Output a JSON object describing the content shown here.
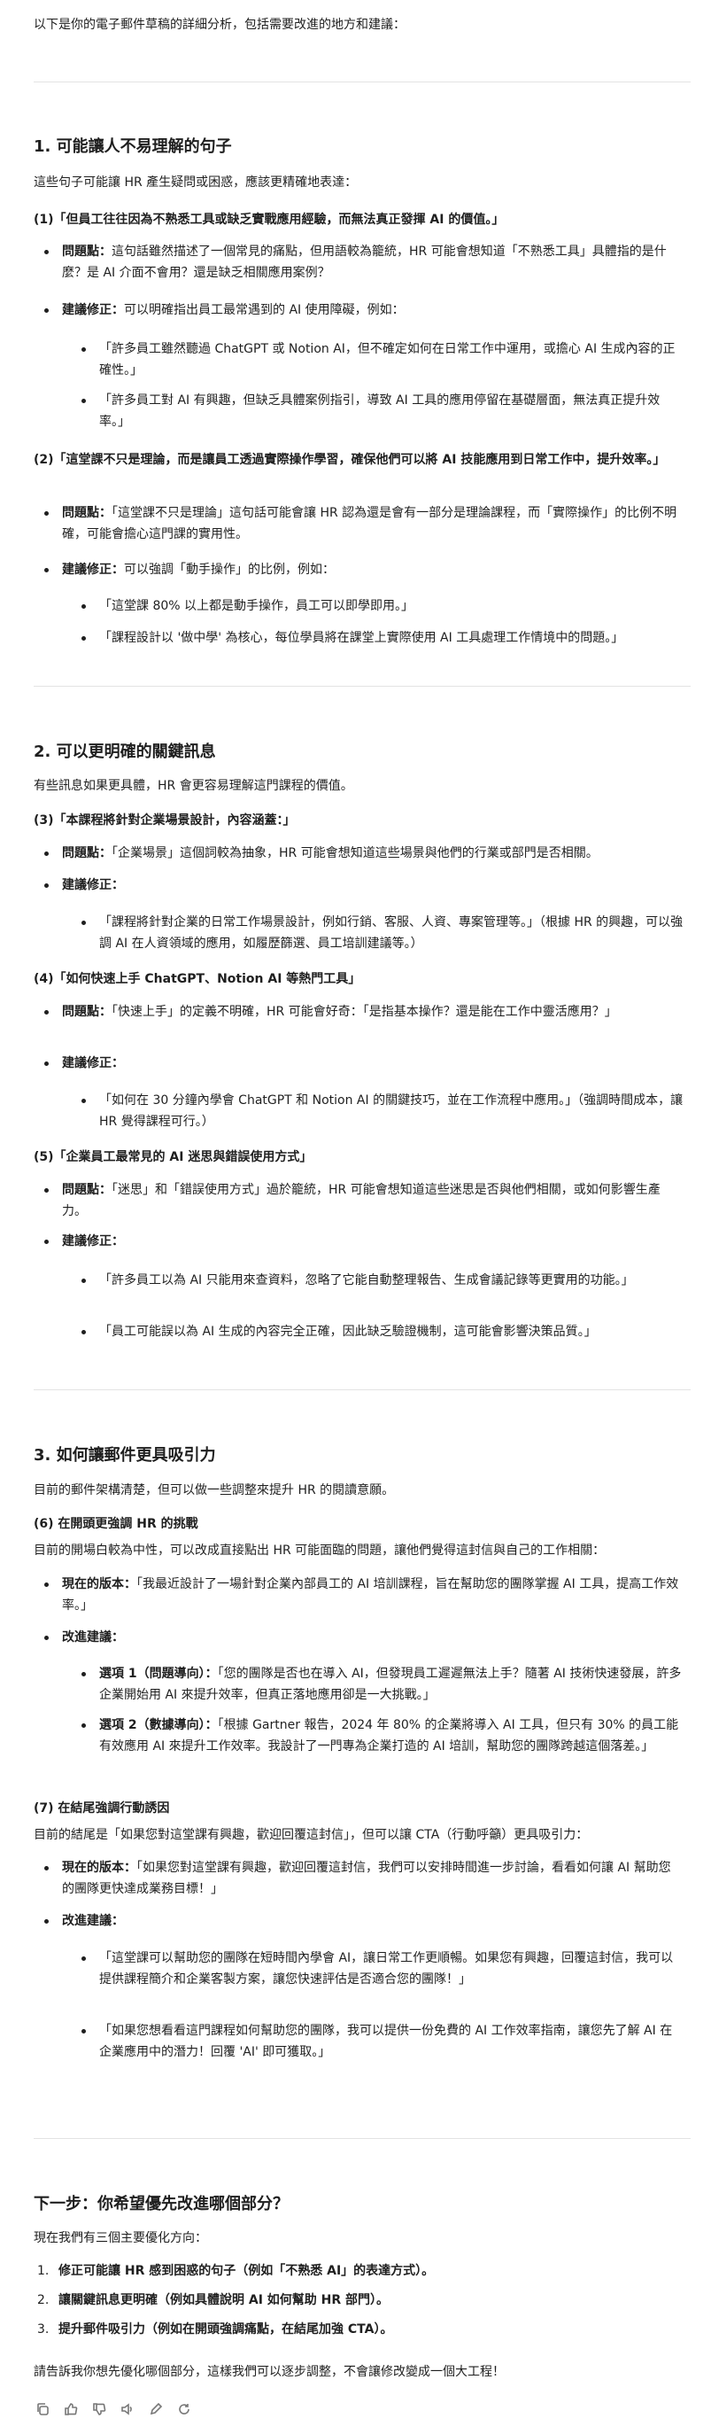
{
  "intro": "以下是你的電子郵件草稿的詳細分析，包括需要改進的地方和建議：",
  "section1": {
    "title": "1. 可能讓人不易理解的句子",
    "desc": "這些句子可能讓 HR 產生疑問或困惑，應該更精確地表達：",
    "q1": "(1)「但員工往往因為不熟悉工具或缺乏實戰應用經驗，而無法真正發揮 AI 的價值。」",
    "q1_problem_label": "問題點：",
    "q1_problem": "這句話雖然描述了一個常見的痛點，但用語較為籠統，HR 可能會想知道「不熟悉工具」具體指的是什麼？是 AI 介面不會用？還是缺乏相關應用案例？",
    "q1_fix_label": "建議修正：",
    "q1_fix": "可以明確指出員工最常遇到的 AI 使用障礙，例如：",
    "q1_s1": "「許多員工雖然聽過 ChatGPT 或 Notion AI，但不確定如何在日常工作中運用，或擔心 AI 生成內容的正確性。」",
    "q1_s2": "「許多員工對 AI 有興趣，但缺乏具體案例指引，導致 AI 工具的應用停留在基礎層面，無法真正提升效率。」",
    "q2": "(2)「這堂課不只是理論，而是讓員工透過實際操作學習，確保他們可以將 AI 技能應用到日常工作中，提升效率。」",
    "q2_problem_label": "問題點：",
    "q2_problem": "「這堂課不只是理論」這句話可能會讓 HR 認為還是會有一部分是理論課程，而「實際操作」的比例不明確，可能會擔心這門課的實用性。",
    "q2_fix_label": "建議修正：",
    "q2_fix": "可以強調「動手操作」的比例，例如：",
    "q2_s1": "「這堂課 80% 以上都是動手操作，員工可以即學即用。」",
    "q2_s2": "「課程設計以 '做中學' 為核心，每位學員將在課堂上實際使用 AI 工具處理工作情境中的問題。」"
  },
  "section2": {
    "title": "2. 可以更明確的關鍵訊息",
    "desc": "有些訊息如果更具體，HR 會更容易理解這門課程的價值。",
    "q3": "(3)「本課程將針對企業場景設計，內容涵蓋：」",
    "q3_problem_label": "問題點：",
    "q3_problem": "「企業場景」這個詞較為抽象，HR 可能會想知道這些場景與他們的行業或部門是否相關。",
    "q3_fix_label": "建議修正：",
    "q3_s1": "「課程將針對企業的日常工作場景設計，例如行銷、客服、人資、專案管理等。」（根據 HR 的興趣，可以強調 AI 在人資領域的應用，如履歷篩選、員工培訓建議等。）",
    "q4": "(4)「如何快速上手 ChatGPT、Notion AI 等熱門工具」",
    "q4_problem_label": "問題點：",
    "q4_problem": "「快速上手」的定義不明確，HR 可能會好奇：「是指基本操作？還是能在工作中靈活應用？」",
    "q4_fix_label": "建議修正：",
    "q4_s1": "「如何在 30 分鐘內學會 ChatGPT 和 Notion AI 的關鍵技巧，並在工作流程中應用。」（強調時間成本，讓 HR 覺得課程可行。）",
    "q5": "(5)「企業員工最常見的 AI 迷思與錯誤使用方式」",
    "q5_problem_label": "問題點：",
    "q5_problem": "「迷思」和「錯誤使用方式」過於籠統，HR 可能會想知道這些迷思是否與他們相關，或如何影響生產力。",
    "q5_fix_label": "建議修正：",
    "q5_s1": "「許多員工以為 AI 只能用來查資料，忽略了它能自動整理報告、生成會議記錄等更實用的功能。」",
    "q5_s2": "「員工可能誤以為 AI 生成的內容完全正確，因此缺乏驗證機制，這可能會影響決策品質。」"
  },
  "section3": {
    "title": "3. 如何讓郵件更具吸引力",
    "desc": "目前的郵件架構清楚，但可以做一些調整來提升 HR 的閱讀意願。",
    "q6": "(6) 在開頭更強調 HR 的挑戰",
    "q6_desc": "目前的開場白較為中性，可以改成直接點出 HR 可能面臨的問題，讓他們覺得這封信與自己的工作相關：",
    "q6_current_label": "現在的版本：",
    "q6_current": "「我最近設計了一場針對企業內部員工的 AI 培訓課程，旨在幫助您的團隊掌握 AI 工具，提高工作效率。」",
    "q6_suggest_label": "改進建議：",
    "q6_opt1_label": "選項 1（問題導向）：",
    "q6_opt1": "「您的團隊是否也在導入 AI，但發現員工遲遲無法上手？隨著 AI 技術快速發展，許多企業開始用 AI 來提升效率，但真正落地應用卻是一大挑戰。」",
    "q6_opt2_label": "選項 2（數據導向）：",
    "q6_opt2": "「根據 Gartner 報告，2024 年 80% 的企業將導入 AI 工具，但只有 30% 的員工能有效應用 AI 來提升工作效率。我設計了一門專為企業打造的 AI 培訓，幫助您的團隊跨越這個落差。」",
    "q7": "(7) 在結尾強調行動誘因",
    "q7_desc": "目前的結尾是「如果您對這堂課有興趣，歡迎回覆這封信」，但可以讓 CTA（行動呼籲）更具吸引力：",
    "q7_current_label": "現在的版本：",
    "q7_current": "「如果您對這堂課有興趣，歡迎回覆這封信，我們可以安排時間進一步討論，看看如何讓 AI 幫助您的團隊更快達成業務目標！」",
    "q7_suggest_label": "改進建議：",
    "q7_s1": "「這堂課可以幫助您的團隊在短時間內學會 AI，讓日常工作更順暢。如果您有興趣，回覆這封信，我可以提供課程簡介和企業客製方案，讓您快速評估是否適合您的團隊！」",
    "q7_s2": "「如果您想看看這門課程如何幫助您的團隊，我可以提供一份免費的 AI 工作效率指南，讓您先了解 AI 在企業應用中的潛力！回覆 'AI' 即可獲取。」"
  },
  "next": {
    "title": "下一步：你希望優先改進哪個部分？",
    "desc": "現在我們有三個主要優化方向：",
    "items": [
      "修正可能讓 HR 感到困惑的句子（例如「不熟悉 AI」的表達方式）。",
      "讓關鍵訊息更明確（例如具體說明 AI 如何幫助 HR 部門）。",
      "提升郵件吸引力（例如在開頭強調痛點，在結尾加強 CTA）。"
    ],
    "closing": "請告訴我你想先優化哪個部分，這樣我們可以逐步調整，不會讓修改變成一個大工程！"
  },
  "toolbar": {
    "icons": [
      "copy-icon",
      "thumbs-up-icon",
      "thumbs-down-icon",
      "read-aloud-icon",
      "edit-icon",
      "regenerate-icon"
    ]
  }
}
